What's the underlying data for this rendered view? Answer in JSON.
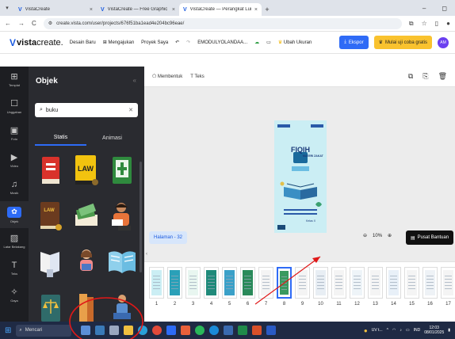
{
  "browser": {
    "tabs": [
      {
        "label": "VistaCreate",
        "active": false
      },
      {
        "label": "VistaCreate — Free Graphic De",
        "active": false
      },
      {
        "label": "VistaCreate — Perangkat Lunak",
        "active": true
      }
    ],
    "url": "create.vista.com/user/projects/676f51ba1ead4e204bc96eae/"
  },
  "header": {
    "logo_bold": "vista",
    "logo_rest": "create.",
    "menu": [
      "Desain Baru",
      "Mengajukan",
      "Proyek Saya",
      "EMODULYOLANDAA..."
    ],
    "ubah_ukuran": "Ubah Ukuran",
    "ekspor": "Ekspor",
    "trial": "Mulai uji coba gratis",
    "avatar": "AM"
  },
  "rail": [
    {
      "label": "Templat",
      "icon": "grid-icon"
    },
    {
      "label": "Unggahan",
      "icon": "upload-icon"
    },
    {
      "label": "Foto",
      "icon": "photo-icon"
    },
    {
      "label": "Video",
      "icon": "video-icon"
    },
    {
      "label": "Musik",
      "icon": "music-icon"
    },
    {
      "label": "Objek",
      "icon": "objects-icon",
      "active": true
    },
    {
      "label": "Latar Belakang",
      "icon": "background-icon"
    },
    {
      "label": "Teks",
      "icon": "text-icon"
    },
    {
      "label": "Gaya",
      "icon": "styles-icon"
    }
  ],
  "panel": {
    "title": "Objek",
    "search_value": "buku",
    "tabs": [
      "Statis",
      "Animasi"
    ]
  },
  "workspace": {
    "toolbar": {
      "membentuk": "Membentuk",
      "teks": "Teks"
    },
    "page_label": "Halaman - 32",
    "zoom": "10%",
    "help": "Pusat Bantuan",
    "cover": {
      "title": "FIQIH",
      "subtitle": "MATERI ZAKAT",
      "class": "Kelas X"
    },
    "page_numbers": [
      "1",
      "2",
      "3",
      "4",
      "5",
      "6",
      "7",
      "8",
      "9",
      "10",
      "11",
      "12",
      "13",
      "14",
      "15",
      "16",
      "17"
    ]
  },
  "taskbar": {
    "search": "Mencari",
    "weather": "UV t...",
    "lang": "IND",
    "time": "12:03",
    "date": "08/01/2025"
  },
  "colors": {
    "accent": "#2f6bf6",
    "trial": "#f9c22e",
    "panel": "#2a2b30",
    "rail": "#1d1e22",
    "annotation": "#e01818"
  }
}
